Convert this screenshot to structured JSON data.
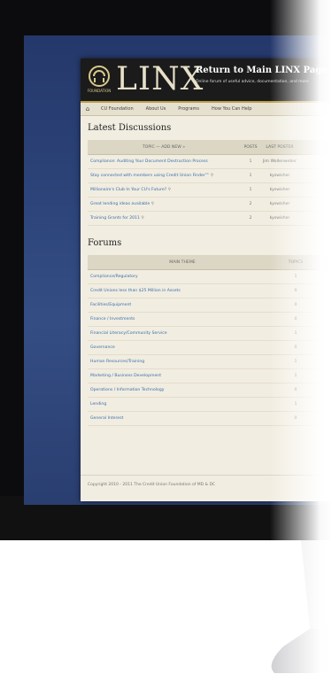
{
  "site": {
    "logo_text": "LINX",
    "logo_sub": "FOUNDATION",
    "return_link": "Return to Main LINX Page",
    "tagline": "Online forum of useful advice, documentation, and more"
  },
  "nav": {
    "home_icon": "home-icon",
    "items": [
      "CU Foundation",
      "About Us",
      "Programs",
      "How You Can Help"
    ]
  },
  "discussions": {
    "title": "Latest Discussions",
    "headers": {
      "topic": "TOPIC — ADD NEW »",
      "posts": "POSTS",
      "last_poster": "LAST POSTER"
    },
    "rows": [
      {
        "topic": "Compliance: Auditing Your Document Destruction Process",
        "posts": "1",
        "poster": "Jim Wollenweber"
      },
      {
        "topic": "Stay connected with members using Credit Union Finder™",
        "posts": "1",
        "poster": "kyswisher"
      },
      {
        "topic": "Millionaire's Club In Your CU's Future?",
        "posts": "1",
        "poster": "kyswisher"
      },
      {
        "topic": "Great lending ideas available",
        "posts": "2",
        "poster": "kyswisher"
      },
      {
        "topic": "Training Grants for 2011",
        "posts": "2",
        "poster": "kyswisher"
      }
    ]
  },
  "forums": {
    "title": "Forums",
    "headers": {
      "theme": "MAIN THEME",
      "topics": "TOPICS"
    },
    "rows": [
      {
        "name": "Compliance/Regulatory",
        "topics": "1"
      },
      {
        "name": "Credit Unions less than $25 Million in Assets",
        "topics": "0"
      },
      {
        "name": "Facilities/Equipment",
        "topics": "0"
      },
      {
        "name": "Finance / Investments",
        "topics": "0"
      },
      {
        "name": "Financial Literacy/Community Service",
        "topics": "1"
      },
      {
        "name": "Governance",
        "topics": "0"
      },
      {
        "name": "Human Resources/Training",
        "topics": "1"
      },
      {
        "name": "Marketing / Business Development",
        "topics": "1"
      },
      {
        "name": "Operations / Information Technology",
        "topics": "0"
      },
      {
        "name": "Lending",
        "topics": "1"
      },
      {
        "name": "General Interest",
        "topics": "0"
      }
    ]
  },
  "footer": {
    "copyright": "Copyright 2010 - 2011 The Credit Union Foundation of MD & DC"
  },
  "colors": {
    "header_bg": "#1b1b1b",
    "accent_gold": "#b89c4a",
    "link_blue": "#3b6ea8",
    "screen_blue": "#2c4479"
  }
}
